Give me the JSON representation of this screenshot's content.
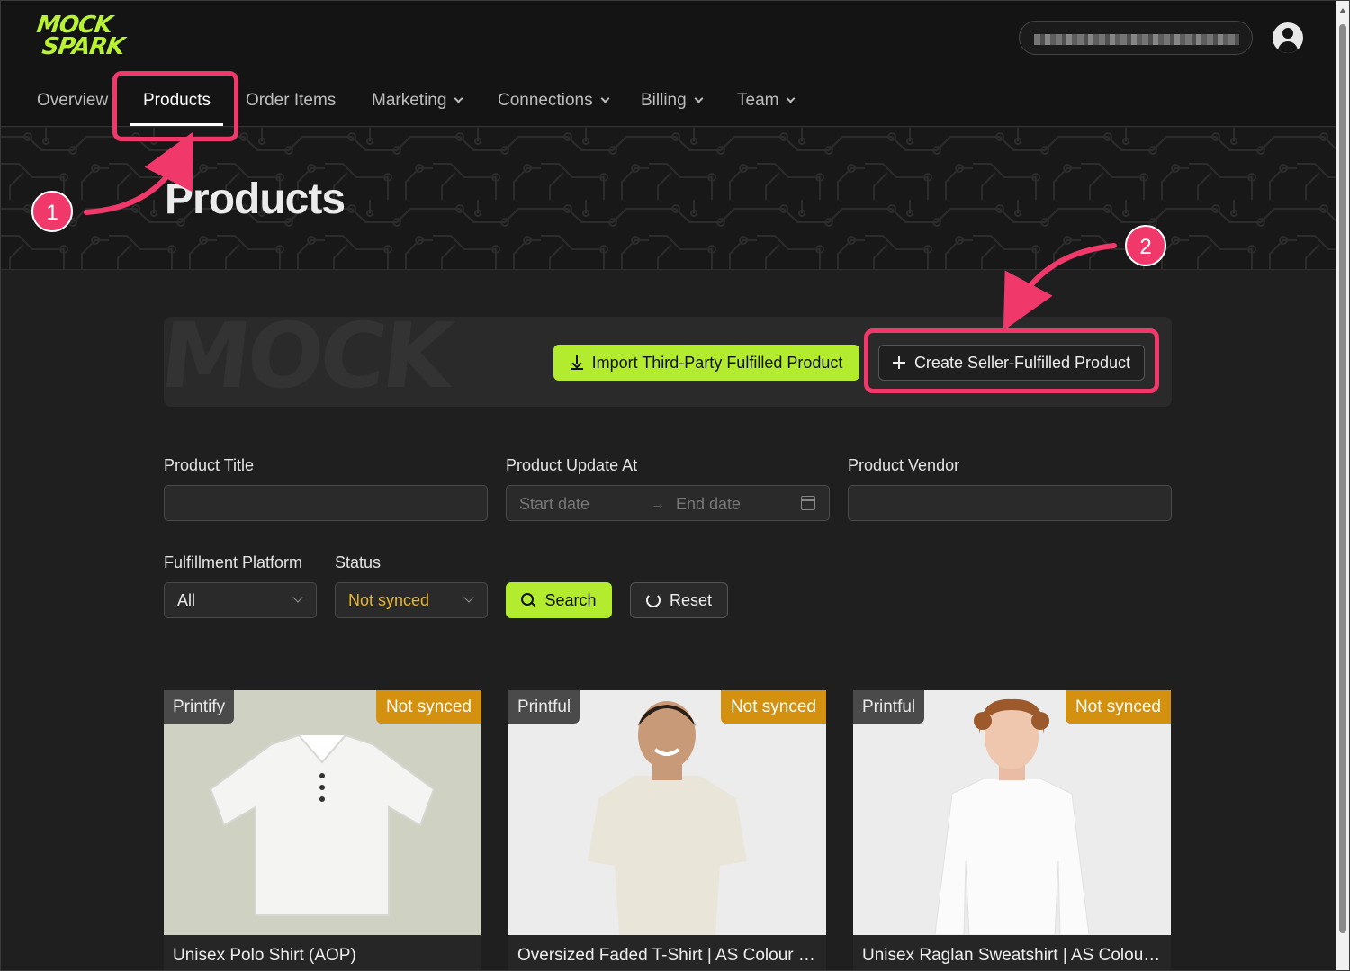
{
  "app": {
    "logo_line1": "MOCK",
    "logo_line2": "SPARK"
  },
  "nav": {
    "items": [
      {
        "label": "Overview",
        "dropdown": false
      },
      {
        "label": "Products",
        "dropdown": false,
        "active": true
      },
      {
        "label": "Order Items",
        "dropdown": false
      },
      {
        "label": "Marketing",
        "dropdown": true
      },
      {
        "label": "Connections",
        "dropdown": true
      },
      {
        "label": "Billing",
        "dropdown": true
      },
      {
        "label": "Team",
        "dropdown": true
      }
    ]
  },
  "header": {
    "account_pill": "",
    "avatar_icon": "user-circle-icon"
  },
  "hero": {
    "title": "Products"
  },
  "actions": {
    "import_label": "Import Third-Party Fulfilled Product",
    "create_label": "Create Seller-Fulfilled Product",
    "banner_watermark": "MOCK SPARK"
  },
  "filters": {
    "product_title": {
      "label": "Product Title",
      "value": ""
    },
    "product_update_at": {
      "label": "Product Update At",
      "start_placeholder": "Start date",
      "end_placeholder": "End date",
      "separator": "→"
    },
    "product_vendor": {
      "label": "Product Vendor",
      "value": ""
    },
    "fulfillment_platform": {
      "label": "Fulfillment Platform",
      "value": "All"
    },
    "status": {
      "label": "Status",
      "value": "Not synced"
    },
    "search_label": "Search",
    "reset_label": "Reset"
  },
  "products": [
    {
      "platform": "Printify",
      "status": "Not synced",
      "title": "Unisex Polo Shirt (AOP)"
    },
    {
      "platform": "Printful",
      "status": "Not synced",
      "title": "Oversized Faded T-Shirt | AS Colour 5..."
    },
    {
      "platform": "Printful",
      "status": "Not synced",
      "title": "Unisex Raglan Sweatshirt | AS Colour ..."
    }
  ],
  "annotations": {
    "step1": "1",
    "step2": "2"
  },
  "colors": {
    "accent": "#b3ec2e",
    "status_badge": "#d4900f",
    "annotation": "#f0386b",
    "background": "#1f1f1f"
  }
}
